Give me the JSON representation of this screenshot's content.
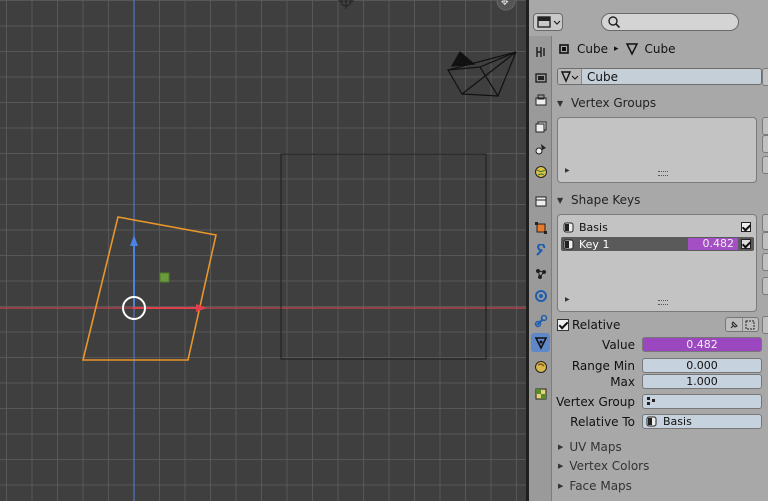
{
  "properties": {
    "breadcrumb": {
      "object": "Cube",
      "mesh": "Cube"
    },
    "mesh_datablock": {
      "name": "Cube"
    },
    "panels": {
      "vertex_groups": {
        "title": "Vertex Groups"
      },
      "shape_keys": {
        "title": "Shape Keys",
        "keys": [
          {
            "name": "Basis",
            "value": "",
            "enabled": true
          },
          {
            "name": "Key 1",
            "value": "0.482",
            "enabled": true,
            "selected": true
          }
        ],
        "relative_label": "Relative",
        "value_label": "Value",
        "value": "0.482",
        "range_min_label": "Range Min",
        "range_min": "0.000",
        "max_label": "Max",
        "max": "1.000",
        "vertex_group_label": "Vertex Group",
        "vertex_group": "",
        "relative_to_label": "Relative To",
        "relative_to": "Basis"
      },
      "uv_maps": {
        "title": "UV Maps"
      },
      "vertex_colors": {
        "title": "Vertex Colors"
      },
      "face_maps": {
        "title": "Face Maps"
      }
    }
  },
  "colors": {
    "selection_outline": "#e7962a",
    "shape_key_value": "#a54fc4",
    "active_tab": "#5f88c8",
    "x_axis": "#d93b45",
    "y_axis": "#3f7ad6"
  }
}
